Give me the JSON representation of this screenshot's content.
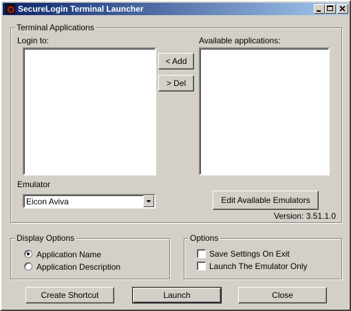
{
  "window": {
    "title": "SecureLogin Terminal Launcher"
  },
  "terminal_applications": {
    "group_label": "Terminal Applications",
    "login_to_label": "Login to:",
    "login_to_items": [],
    "available_label": "Available applications:",
    "available_items": [],
    "add_button": "< Add",
    "del_button": "> Del",
    "emulator_label": "Emulator",
    "emulator_selected": "Eicon Aviva",
    "edit_emulators_button": "Edit Available Emulators",
    "version": "Version: 3.51.1.0"
  },
  "display_options": {
    "group_label": "Display Options",
    "options": [
      {
        "label": "Application Name",
        "checked": true
      },
      {
        "label": "Application Description",
        "checked": false
      }
    ]
  },
  "options": {
    "group_label": "Options",
    "items": [
      {
        "label": "Save Settings On Exit",
        "checked": false
      },
      {
        "label": "Launch The Emulator Only",
        "checked": false
      }
    ]
  },
  "footer": {
    "create_shortcut": "Create Shortcut",
    "launch": "Launch",
    "close": "Close"
  },
  "icons": {
    "app": "securelogin-app-icon",
    "minimize": "minimize-icon",
    "maximize": "maximize-icon",
    "close": "close-icon",
    "dropdown": "chevron-down-icon"
  }
}
